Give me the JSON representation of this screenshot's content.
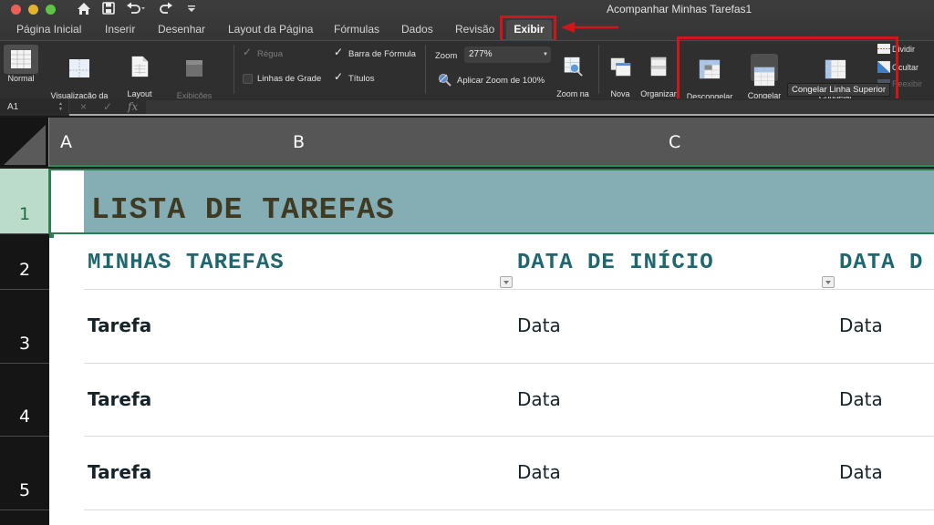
{
  "window": {
    "title": "Acompanhar Minhas Tarefas1"
  },
  "quick_access": {
    "home_icon": "home-icon",
    "save_icon": "save-icon",
    "undo_icon": "undo-icon",
    "redo_icon": "redo-icon",
    "customize_icon": "customize-toolbar-icon"
  },
  "tabs": [
    {
      "label": "Página Inicial"
    },
    {
      "label": "Inserir"
    },
    {
      "label": "Desenhar"
    },
    {
      "label": "Layout da Página"
    },
    {
      "label": "Fórmulas"
    },
    {
      "label": "Dados"
    },
    {
      "label": "Revisão"
    },
    {
      "label": "Exibir",
      "active": true
    }
  ],
  "ribbon": {
    "views": [
      {
        "label": "Normal",
        "icon": "normal-view-icon"
      },
      {
        "label": "Visualização da\nQuebra de Página",
        "icon": "page-break-preview-icon"
      },
      {
        "label": "Layout\nde Página",
        "icon": "page-layout-icon"
      },
      {
        "label": "Exibições\nPersonalizadas",
        "icon": "custom-views-icon",
        "disabled": true
      }
    ],
    "show": {
      "ruler": {
        "label": "Régua",
        "checked": true,
        "disabled": true
      },
      "gridlines": {
        "label": "Linhas de Grade",
        "checked": false
      },
      "formula_bar": {
        "label": "Barra de Fórmula",
        "checked": true
      },
      "headings": {
        "label": "Títulos",
        "checked": true
      }
    },
    "zoom": {
      "label": "Zoom",
      "value": "277%",
      "apply_100": "Aplicar Zoom de 100%",
      "zoom_selection": "Zoom na\nSeleção"
    },
    "window": {
      "new_window": "Nova\nJanela",
      "arrange_all": "Organizar\nTudo",
      "unfreeze_panes": "Descongelar\nPainéis",
      "freeze_top_row": "Congelar\nLinha Supe",
      "freeze_first_column": "Congelar",
      "split": "Dividir",
      "hide": "Ocultar",
      "unhide": "Reexibir"
    },
    "tooltip": "Congelar Linha Superior"
  },
  "formula_bar": {
    "name_box": "A1",
    "cancel_icon": "×",
    "enter_icon": "✓",
    "fx": "fx",
    "value": ""
  },
  "grid": {
    "columns": [
      "A",
      "B",
      "C"
    ],
    "rows": [
      "1",
      "2",
      "3",
      "4",
      "5"
    ],
    "selected_row": "1",
    "title": "LISTA DE TAREFAS",
    "headers": [
      "MINHAS TAREFAS",
      "DATA DE INÍCIO",
      "DATA D"
    ],
    "data_rows": [
      [
        "Tarefa",
        "Data",
        "Data"
      ],
      [
        "Tarefa",
        "Data",
        "Data"
      ],
      [
        "Tarefa",
        "Data",
        "Data"
      ]
    ]
  },
  "colors": {
    "title_band": "#85adb4",
    "title_text": "#3f3a23",
    "header_text": "#1e6670",
    "selection": "#2e7d50",
    "annotation": "#d0161b"
  }
}
